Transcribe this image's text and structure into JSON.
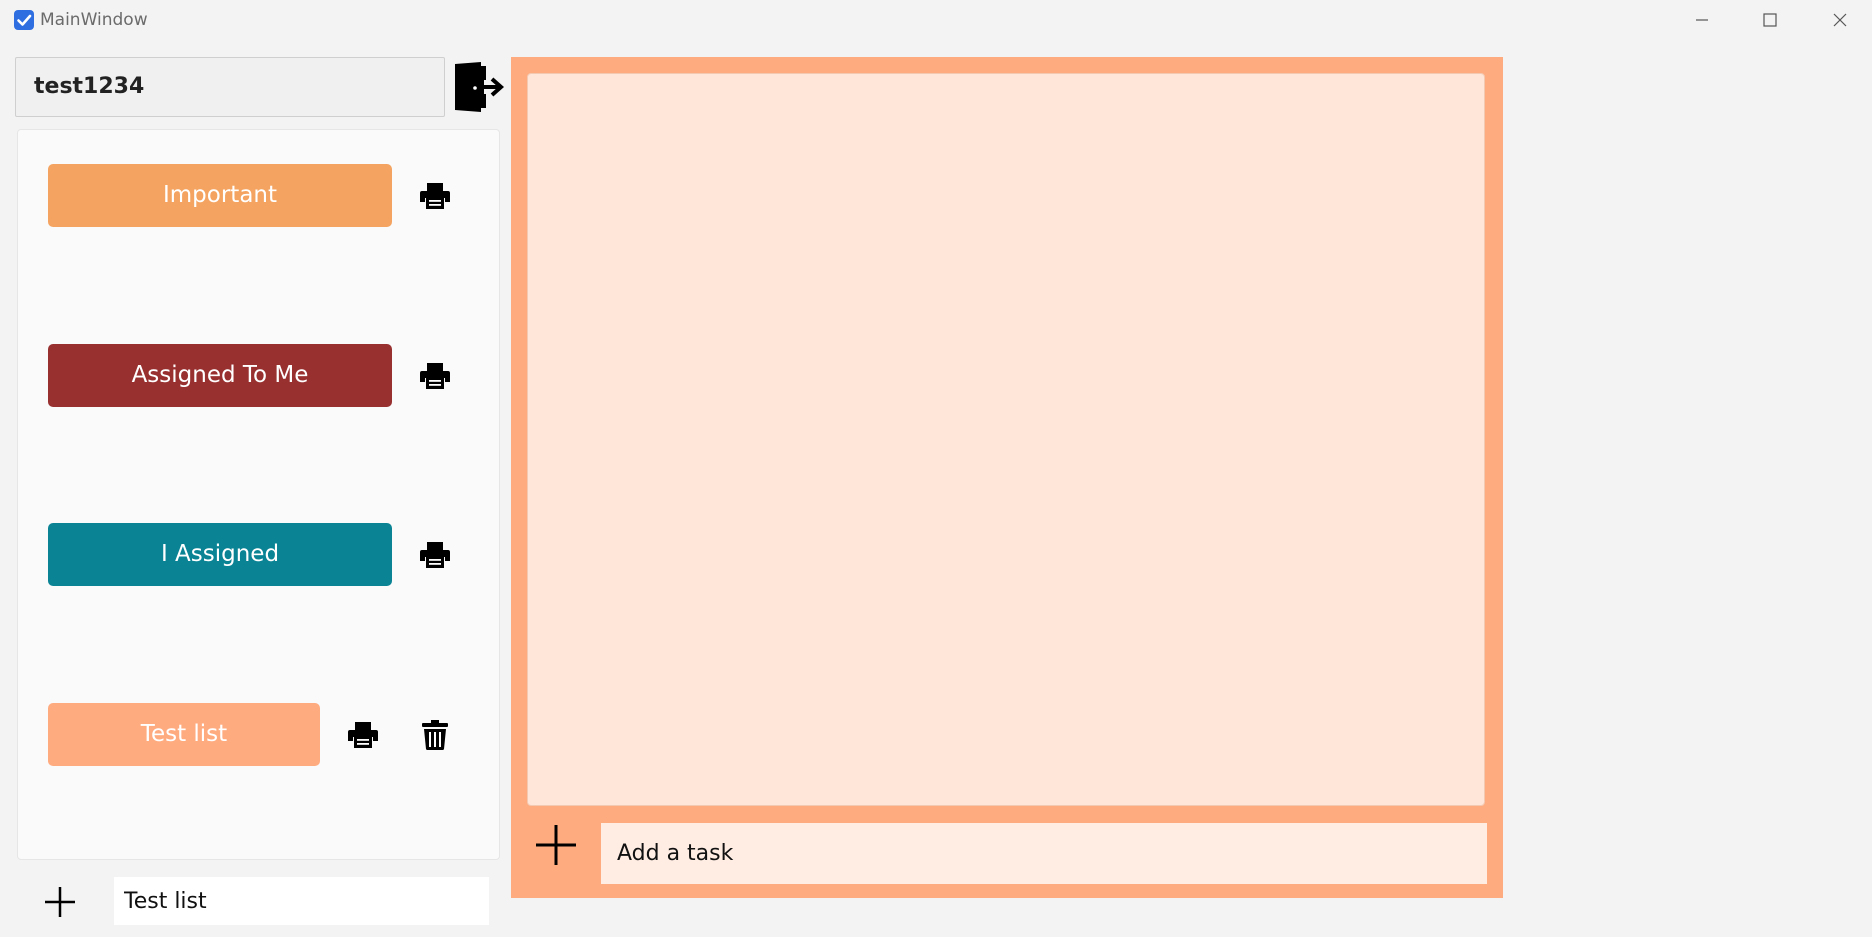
{
  "window": {
    "title": "MainWindow",
    "app_icon": "checkbox-icon",
    "controls": [
      "minimize-icon",
      "maximize-icon",
      "close-icon"
    ]
  },
  "user": {
    "username": "test1234",
    "logout_icon": "logout-door-icon"
  },
  "lists": [
    {
      "label": "Important",
      "color": "#f4a460",
      "actions": [
        "print-icon"
      ]
    },
    {
      "label": "Assigned To Me",
      "color": "#983030",
      "actions": [
        "print-icon"
      ]
    },
    {
      "label": "I Assigned",
      "color": "#0a8495",
      "actions": [
        "print-icon"
      ]
    },
    {
      "label": "Test list",
      "color": "#ffab80",
      "actions": [
        "print-icon",
        "trash-icon"
      ]
    }
  ],
  "new_list": {
    "value": "Test list",
    "add_icon": "plus-icon"
  },
  "tasks": {
    "panel_color": "#ffab80",
    "add_icon": "plus-icon",
    "input_placeholder": "Add a task",
    "items": []
  }
}
